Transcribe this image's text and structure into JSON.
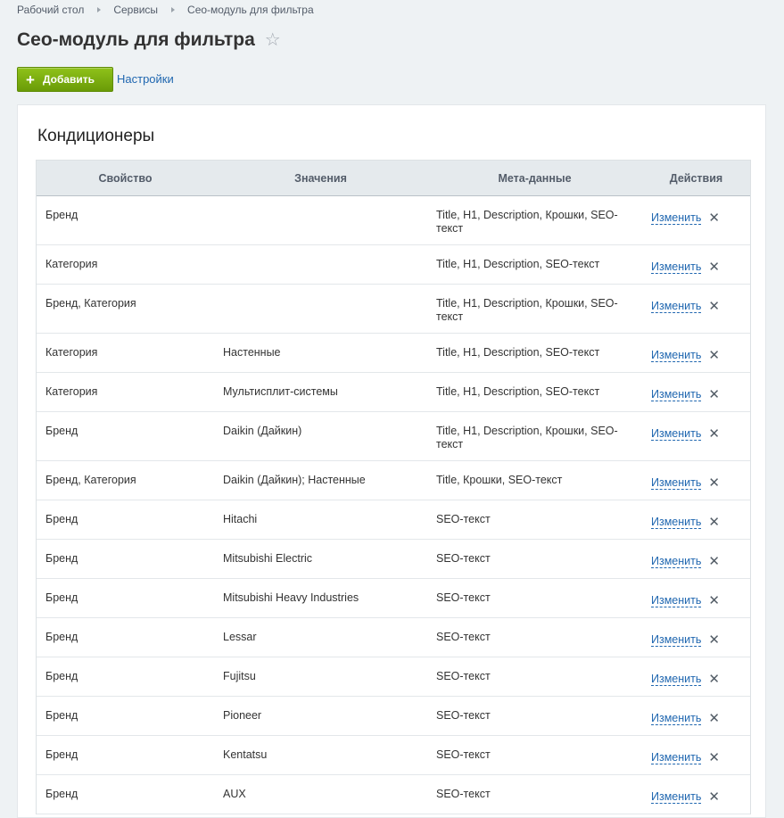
{
  "breadcrumb": [
    "Рабочий стол",
    "Сервисы",
    "Сео-модуль для фильтра"
  ],
  "page_title": "Сео-модуль для фильтра",
  "toolbar": {
    "add_label": "Добавить",
    "settings_label": "Настройки"
  },
  "section_title": "Кондиционеры",
  "table": {
    "headers": [
      "Свойство",
      "Значения",
      "Мета-данные",
      "Действия"
    ],
    "edit_label": "Изменить",
    "rows": [
      {
        "property": "Бренд",
        "values": "",
        "meta": "Title, H1, Description, Крошки, SEO-текст"
      },
      {
        "property": "Категория",
        "values": "",
        "meta": "Title, H1, Description, SEO-текст"
      },
      {
        "property": "Бренд, Категория",
        "values": "",
        "meta": "Title, H1, Description, Крошки, SEO-текст"
      },
      {
        "property": "Категория",
        "values": "Настенные",
        "meta": "Title, H1, Description, SEO-текст"
      },
      {
        "property": "Категория",
        "values": "Мультисплит-системы",
        "meta": "Title, H1, Description, SEO-текст"
      },
      {
        "property": "Бренд",
        "values": "Daikin (Дайкин)",
        "meta": "Title, H1, Description, Крошки, SEO-текст"
      },
      {
        "property": "Бренд, Категория",
        "values": "Daikin (Дайкин); Настенные",
        "meta": "Title, Крошки, SEO-текст"
      },
      {
        "property": "Бренд",
        "values": "Hitachi",
        "meta": "SEO-текст"
      },
      {
        "property": "Бренд",
        "values": "Mitsubishi Electric",
        "meta": "SEO-текст"
      },
      {
        "property": "Бренд",
        "values": "Mitsubishi Heavy Industries",
        "meta": "SEO-текст"
      },
      {
        "property": "Бренд",
        "values": "Lessar",
        "meta": "SEO-текст"
      },
      {
        "property": "Бренд",
        "values": "Fujitsu",
        "meta": "SEO-текст"
      },
      {
        "property": "Бренд",
        "values": "Pioneer",
        "meta": "SEO-текст"
      },
      {
        "property": "Бренд",
        "values": "Kentatsu",
        "meta": "SEO-текст"
      },
      {
        "property": "Бренд",
        "values": "AUX",
        "meta": "SEO-текст"
      }
    ]
  },
  "icons": {
    "star": "star-icon",
    "plus": "plus-icon",
    "delete": "close-icon"
  }
}
